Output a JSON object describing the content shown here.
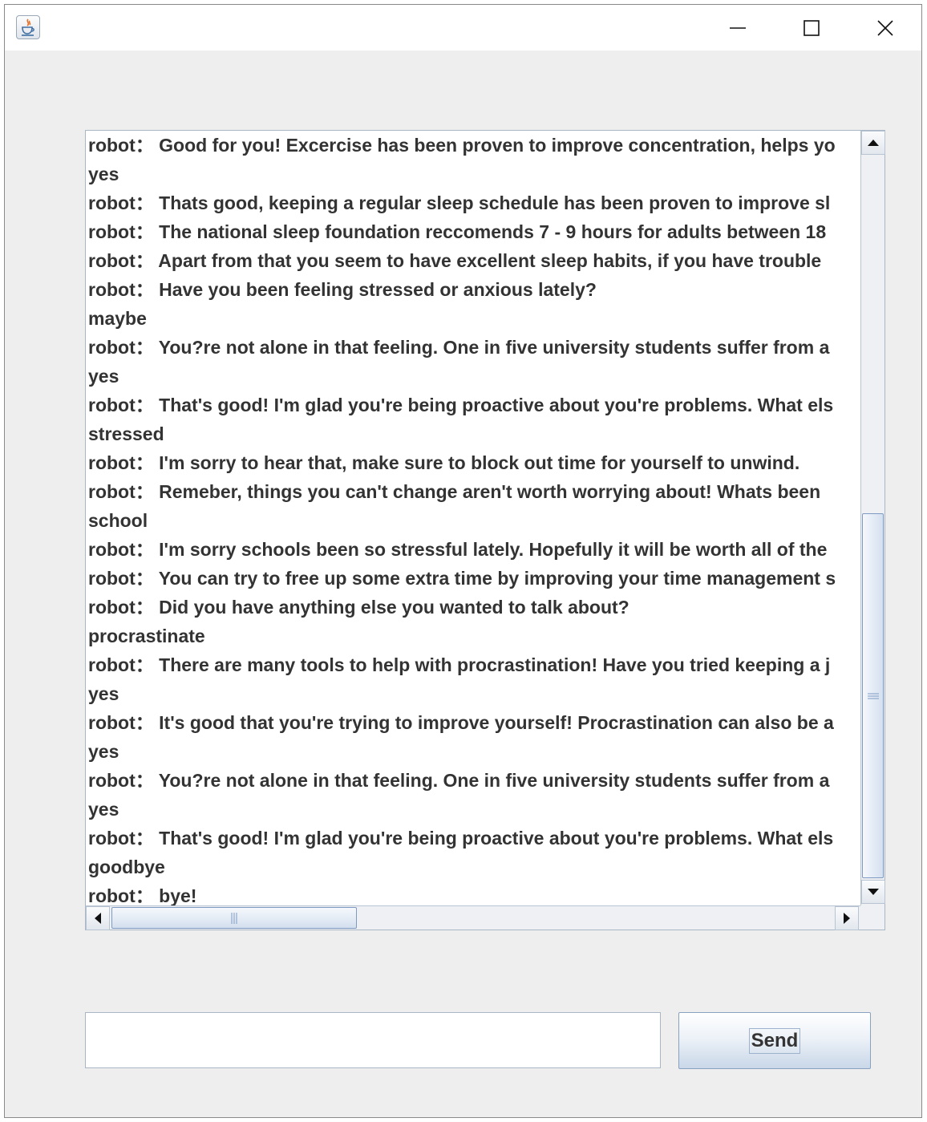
{
  "window": {
    "icon": "java-icon",
    "controls": {
      "minimize": "minimize-icon",
      "maximize": "maximize-icon",
      "close": "close-icon"
    }
  },
  "chat": {
    "lines": [
      "robot： Good for you! Excercise has been proven to improve concentration, helps yo",
      "yes",
      "robot： Thats good, keeping a regular sleep schedule has been proven to improve sl",
      "robot： The national sleep foundation reccomends 7 - 9 hours for adults between 18",
      "robot： Apart from that you seem to have excellent sleep habits, if you have trouble",
      "robot： Have you been feeling stressed or anxious lately?",
      "maybe",
      "robot： You?re not alone in that feeling. One in five university students suffer from a",
      "yes",
      "robot： That's good! I'm glad you're being proactive about you're problems. What els",
      "stressed",
      "robot： I'm sorry to hear that, make sure to block out time for yourself to unwind.",
      "robot： Remeber, things you can't change aren't worth worrying about! Whats been",
      "school",
      "robot： I'm sorry schools been so stressful lately. Hopefully it will be worth all of the",
      "robot： You can try to free up some extra time by improving your time management s",
      "robot： Did you have anything else you wanted to talk about?",
      "procrastinate",
      "robot： There are many tools to help with procrastination! Have you tried keeping a j",
      "yes",
      "robot： It's good that you're trying to improve yourself! Procrastination can also be a",
      "yes",
      "robot： You?re not alone in that feeling. One in five university students suffer from a",
      "yes",
      "robot： That's good! I'm glad you're being proactive about you're problems. What els",
      "goodbye",
      "robot： bye!"
    ],
    "vertical_scroll_position": 0.5,
    "horizontal_scroll_position": 0.0
  },
  "input": {
    "value": "",
    "placeholder": ""
  },
  "send_button": {
    "label": "Send"
  }
}
